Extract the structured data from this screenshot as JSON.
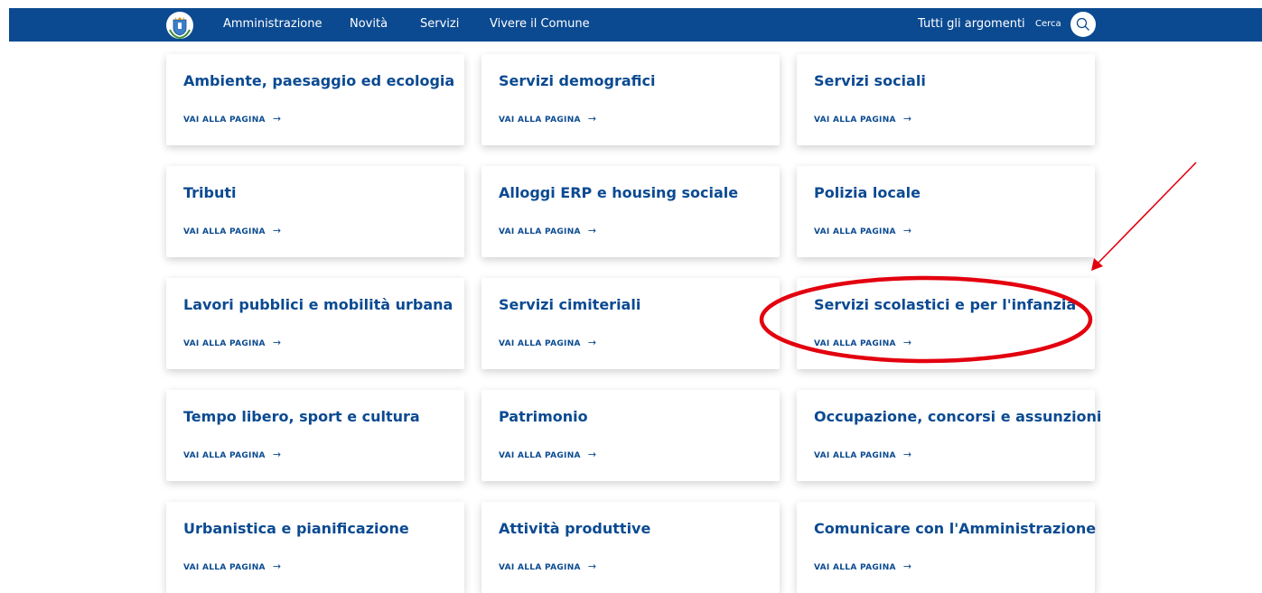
{
  "nav": {
    "items": [
      {
        "label": "Amministrazione"
      },
      {
        "label": "Novità"
      },
      {
        "label": "Servizi"
      },
      {
        "label": "Vivere il Comune"
      }
    ],
    "topics_label": "Tutti gli argomenti",
    "search_label": "Cerca",
    "search_icon": "search-icon",
    "logo_icon": "municipal-crest-icon"
  },
  "cards": [
    {
      "title": "Ambiente, paesaggio ed ecologia",
      "link": "VAI ALLA PAGINA"
    },
    {
      "title": "Servizi demografici",
      "link": "VAI ALLA PAGINA"
    },
    {
      "title": "Servizi sociali",
      "link": "VAI ALLA PAGINA"
    },
    {
      "title": "Tributi",
      "link": "VAI ALLA PAGINA"
    },
    {
      "title": "Alloggi ERP e housing sociale",
      "link": "VAI ALLA PAGINA"
    },
    {
      "title": "Polizia locale",
      "link": "VAI ALLA PAGINA"
    },
    {
      "title": "Lavori pubblici e mobilità urbana",
      "link": "VAI ALLA PAGINA"
    },
    {
      "title": "Servizi cimiteriali",
      "link": "VAI ALLA PAGINA"
    },
    {
      "title": "Servizi scolastici e per l'infanzia",
      "link": "VAI ALLA PAGINA"
    },
    {
      "title": "Tempo libero, sport e cultura",
      "link": "VAI ALLA PAGINA"
    },
    {
      "title": "Patrimonio",
      "link": "VAI ALLA PAGINA"
    },
    {
      "title": "Occupazione, concorsi e assunzioni",
      "link": "VAI ALLA PAGINA"
    },
    {
      "title": "Urbanistica e pianificazione",
      "link": "VAI ALLA PAGINA"
    },
    {
      "title": "Attività produttive",
      "link": "VAI ALLA PAGINA"
    },
    {
      "title": "Comunicare con l'Amministrazione",
      "link": "VAI ALLA PAGINA"
    }
  ],
  "colors": {
    "brand_blue": "#0b4a91",
    "annotation_red": "#e3000f"
  }
}
